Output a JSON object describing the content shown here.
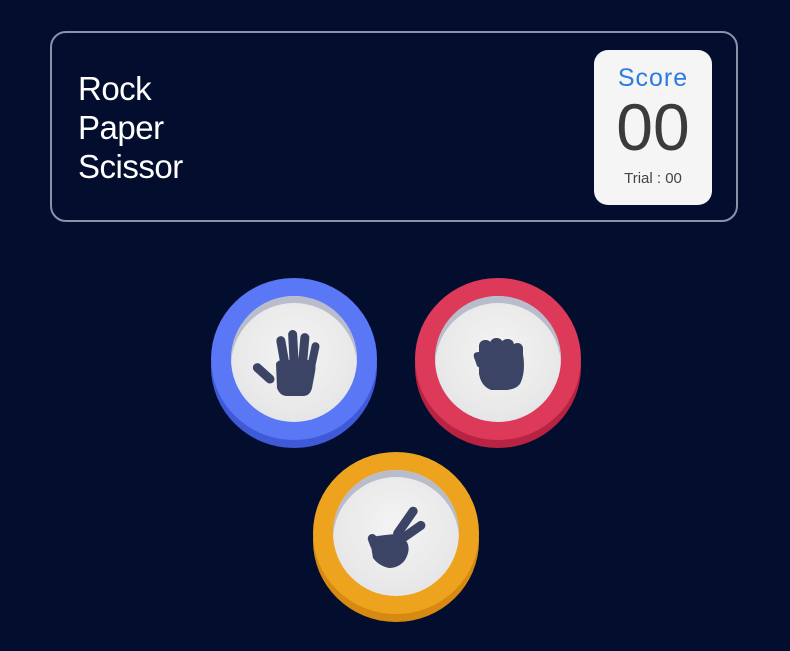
{
  "header": {
    "title_lines": [
      "Rock",
      "Paper",
      "Scissor"
    ],
    "score_label": "Score",
    "score_value": "00",
    "trial_text": "Trial : 00"
  },
  "choices": [
    {
      "id": "paper",
      "icon": "open-hand-icon",
      "color": "#5a77f5"
    },
    {
      "id": "rock",
      "icon": "fist-icon",
      "color": "#dd3a5a"
    },
    {
      "id": "scissors",
      "icon": "peace-hand-icon",
      "color": "#eea31f"
    }
  ],
  "colors": {
    "background": "#030e2e",
    "icon_fill": "#3c4466",
    "score_label": "#2d7be0"
  }
}
